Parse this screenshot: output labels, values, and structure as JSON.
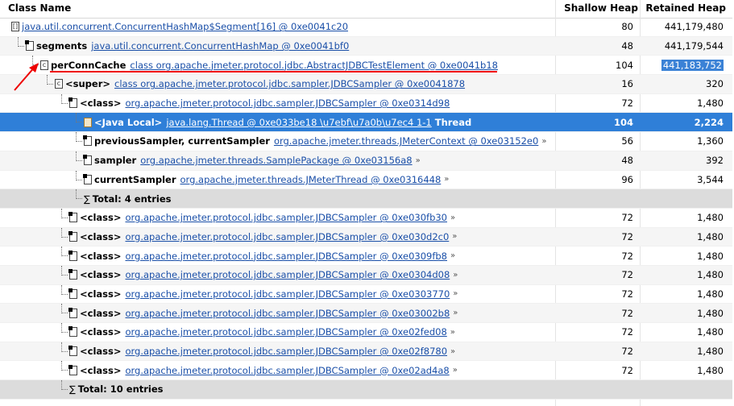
{
  "header": {
    "class_name": "Class Name",
    "shallow_heap": "Shallow Heap",
    "retained_heap": "Retained Heap"
  },
  "rows": [
    {
      "icon": "array-icon",
      "name": "",
      "link": "java.util.concurrent.ConcurrentHashMap$Segment[16] @ 0xe0041c20",
      "suffix": "",
      "shallow": "80",
      "retained": "441,179,480",
      "indent": 0
    },
    {
      "icon": "object-icon",
      "name": "segments",
      "link": "java.util.concurrent.ConcurrentHashMap @ 0xe0041bf0",
      "suffix": "",
      "shallow": "48",
      "retained": "441,179,544",
      "indent": 1
    },
    {
      "icon": "class-icon",
      "name": "perConnCache",
      "link": "class org.apache.jmeter.protocol.jdbc.AbstractJDBCTestElement @ 0xe0041b18",
      "suffix": "",
      "shallow": "104",
      "retained": "441,183,752",
      "indent": 2
    },
    {
      "icon": "class-icon",
      "name": "<super>",
      "link": "class org.apache.jmeter.protocol.jdbc.sampler.JDBCSampler @ 0xe0041878",
      "suffix": "",
      "shallow": "16",
      "retained": "320",
      "indent": 3
    },
    {
      "icon": "object-icon",
      "name": "<class>",
      "link": "org.apache.jmeter.protocol.jdbc.sampler.JDBCSampler @ 0xe0314d98",
      "suffix": "",
      "shallow": "72",
      "retained": "1,480",
      "indent": 4
    },
    {
      "icon": "local-icon",
      "name": "<Java Local>",
      "link": "java.lang.Thread @ 0xe033be18 \\u7ebf\\u7a0b\\u7ec4 1-1",
      "suffix": "Thread",
      "shallow": "104",
      "retained": "2,224",
      "indent": 5,
      "selected": true
    },
    {
      "icon": "object-icon",
      "name": "previousSampler, currentSampler",
      "link": "org.apache.jmeter.threads.JMeterContext @ 0xe03152e0",
      "suffix": "»",
      "shallow": "56",
      "retained": "1,360",
      "indent": 5
    },
    {
      "icon": "object-icon",
      "name": "sampler",
      "link": "org.apache.jmeter.threads.SamplePackage @ 0xe03156a8",
      "suffix": "»",
      "shallow": "48",
      "retained": "392",
      "indent": 5
    },
    {
      "icon": "object-icon",
      "name": "currentSampler",
      "link": "org.apache.jmeter.threads.JMeterThread @ 0xe0316448",
      "suffix": "»",
      "shallow": "96",
      "retained": "3,544",
      "indent": 5
    },
    {
      "icon": "sigma",
      "name": "Total: 4 entries",
      "link": "",
      "suffix": "",
      "shallow": "",
      "retained": "",
      "indent": 5,
      "total": true
    },
    {
      "icon": "object-icon",
      "name": "<class>",
      "link": "org.apache.jmeter.protocol.jdbc.sampler.JDBCSampler @ 0xe030fb30",
      "suffix": "»",
      "shallow": "72",
      "retained": "1,480",
      "indent": 4
    },
    {
      "icon": "object-icon",
      "name": "<class>",
      "link": "org.apache.jmeter.protocol.jdbc.sampler.JDBCSampler @ 0xe030d2c0",
      "suffix": "»",
      "shallow": "72",
      "retained": "1,480",
      "indent": 4
    },
    {
      "icon": "object-icon",
      "name": "<class>",
      "link": "org.apache.jmeter.protocol.jdbc.sampler.JDBCSampler @ 0xe0309fb8",
      "suffix": "»",
      "shallow": "72",
      "retained": "1,480",
      "indent": 4
    },
    {
      "icon": "object-icon",
      "name": "<class>",
      "link": "org.apache.jmeter.protocol.jdbc.sampler.JDBCSampler @ 0xe0304d08",
      "suffix": "»",
      "shallow": "72",
      "retained": "1,480",
      "indent": 4
    },
    {
      "icon": "object-icon",
      "name": "<class>",
      "link": "org.apache.jmeter.protocol.jdbc.sampler.JDBCSampler @ 0xe0303770",
      "suffix": "»",
      "shallow": "72",
      "retained": "1,480",
      "indent": 4
    },
    {
      "icon": "object-icon",
      "name": "<class>",
      "link": "org.apache.jmeter.protocol.jdbc.sampler.JDBCSampler @ 0xe03002b8",
      "suffix": "»",
      "shallow": "72",
      "retained": "1,480",
      "indent": 4
    },
    {
      "icon": "object-icon",
      "name": "<class>",
      "link": "org.apache.jmeter.protocol.jdbc.sampler.JDBCSampler @ 0xe02fed08",
      "suffix": "»",
      "shallow": "72",
      "retained": "1,480",
      "indent": 4
    },
    {
      "icon": "object-icon",
      "name": "<class>",
      "link": "org.apache.jmeter.protocol.jdbc.sampler.JDBCSampler @ 0xe02f8780",
      "suffix": "»",
      "shallow": "72",
      "retained": "1,480",
      "indent": 4
    },
    {
      "icon": "object-icon",
      "name": "<class>",
      "link": "org.apache.jmeter.protocol.jdbc.sampler.JDBCSampler @ 0xe02ad4a8",
      "suffix": "»",
      "shallow": "72",
      "retained": "1,480",
      "indent": 4
    },
    {
      "icon": "sigma",
      "name": "Total: 10 entries",
      "link": "",
      "suffix": "",
      "shallow": "",
      "retained": "",
      "indent": 4,
      "total": true
    }
  ],
  "colors": {
    "selection": "#2f7fd8",
    "link": "#1a4fa8",
    "annotation": "#e00000"
  }
}
